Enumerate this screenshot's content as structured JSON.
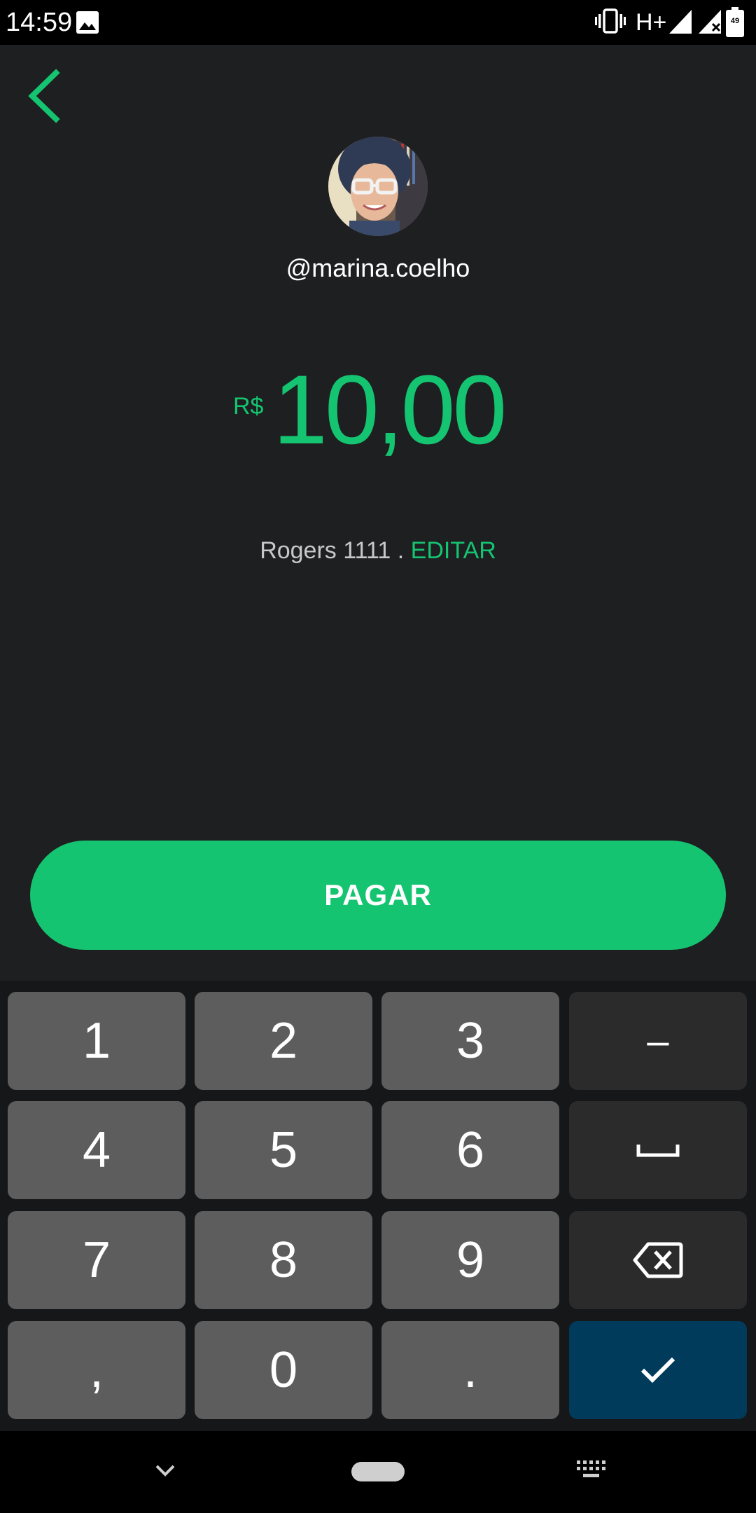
{
  "status_bar": {
    "time": "14:59",
    "network_type": "H+",
    "battery_level": "49",
    "icons": [
      "photo-icon",
      "vibrate-icon",
      "signal-icon",
      "signal-no-data-icon",
      "battery-icon"
    ]
  },
  "header": {
    "back_icon": "chevron-left-icon",
    "username": "@marina.coelho"
  },
  "amount": {
    "currency": "R$",
    "value": "10,00"
  },
  "payment_method": {
    "card": "Rogers 1111 .",
    "edit_label": "EDITAR"
  },
  "pay_button": {
    "label": "PAGAR"
  },
  "keyboard": {
    "keys": [
      {
        "label": "1"
      },
      {
        "label": "2"
      },
      {
        "label": "3"
      },
      {
        "label": "–"
      },
      {
        "label": "4"
      },
      {
        "label": "5"
      },
      {
        "label": "6"
      },
      {
        "label": "",
        "icon": "space-icon"
      },
      {
        "label": "7"
      },
      {
        "label": "8"
      },
      {
        "label": "9"
      },
      {
        "label": "",
        "icon": "backspace-icon"
      },
      {
        "label": ","
      },
      {
        "label": "0"
      },
      {
        "label": "."
      },
      {
        "label": "",
        "icon": "checkmark-icon"
      }
    ]
  },
  "nav_bar": {
    "icons": [
      "chevron-down-icon",
      "home-pill-icon",
      "keyboard-icon"
    ]
  },
  "colors": {
    "accent": "#15c470",
    "background": "#1e1f21",
    "key": "#5d5d5d",
    "key_function": "#2b2b2c",
    "key_confirm": "#003b5c"
  }
}
